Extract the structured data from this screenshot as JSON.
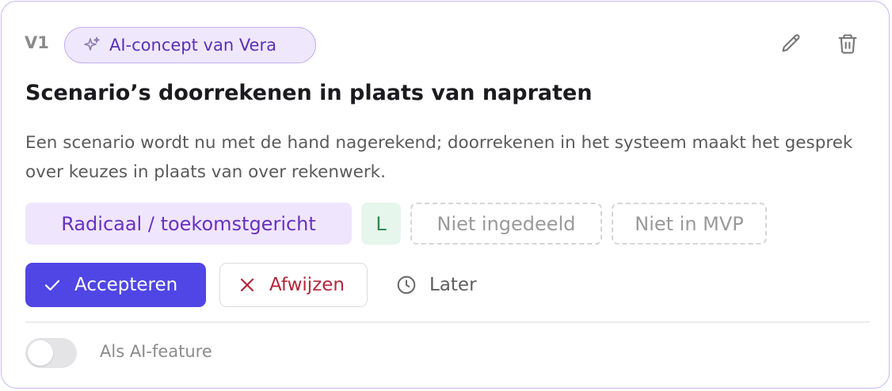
{
  "card": {
    "version": "V1",
    "ai_badge": {
      "label": "AI-concept van Vera",
      "icon": "sparkles-icon"
    },
    "actions": {
      "edit_icon": "pencil-icon",
      "delete_icon": "trash-icon"
    },
    "title": "Scenario’s doorrekenen in plaats van napraten",
    "description": "Een scenario wordt nu met de hand nagerekend; doorrekenen in het systeem maakt het gesprek over keuzes in plaats van over rekenwerk.",
    "tags": {
      "category": "Radicaal / toekomstgericht",
      "size": "L",
      "classification": "Niet ingedeeld",
      "mvp": "Niet in MVP"
    },
    "buttons": {
      "accept": "Accepteren",
      "reject": "Afwijzen",
      "later": "Later"
    },
    "toggle": {
      "label": "Als AI-feature",
      "on": false
    },
    "colors": {
      "accent": "#4f46e5",
      "ai_purple": "#5b2fb8",
      "reject_red": "#b3263a",
      "size_green": "#2d8a4e"
    }
  }
}
